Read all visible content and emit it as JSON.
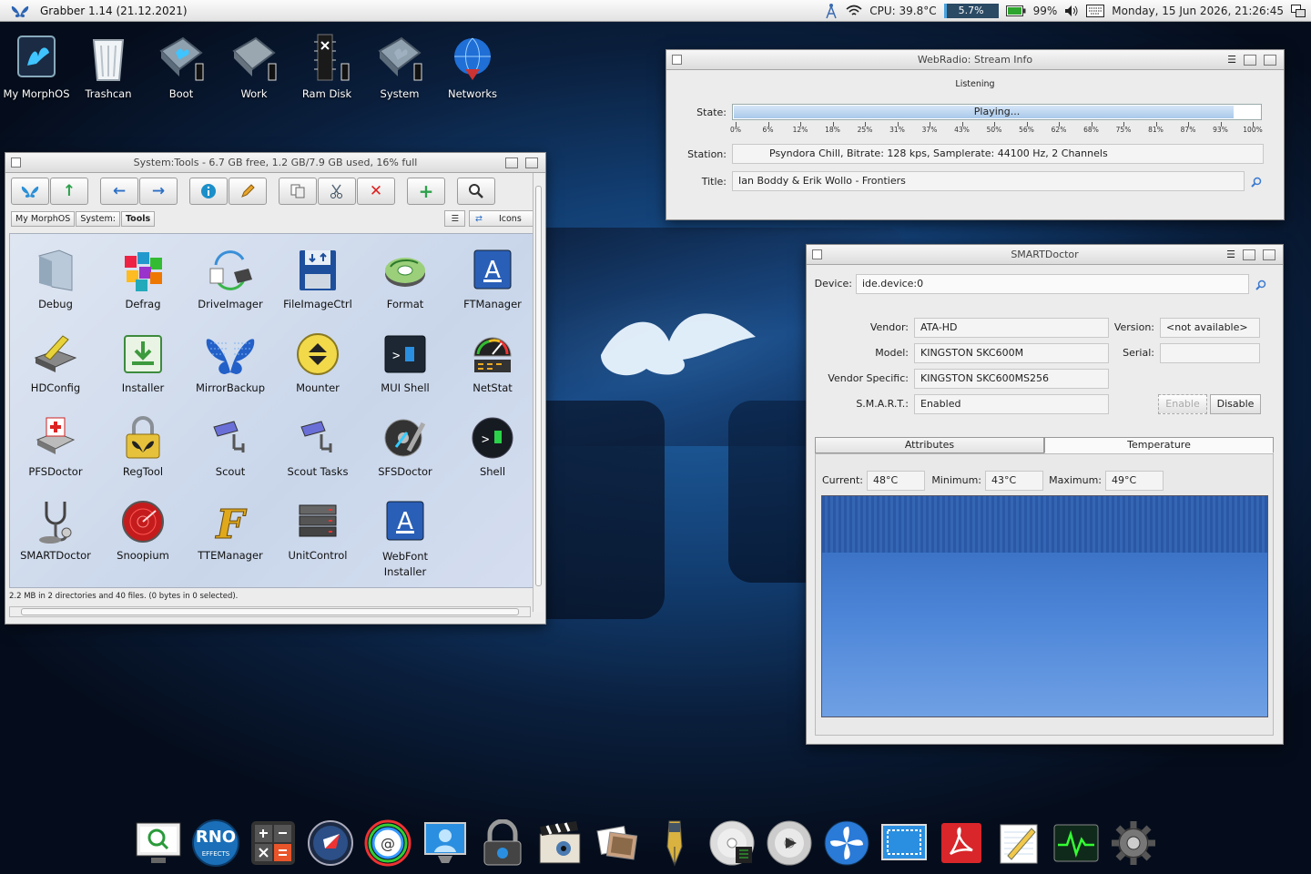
{
  "topbar": {
    "title": "Grabber 1.14 (21.12.2021)",
    "cpu_temp": "CPU: 39.8°C",
    "cpu_load": "5.7%",
    "cpu_load_fraction": 0.057,
    "battery": "99%",
    "datetime": "Monday, 15 Jun 2026, 21:26:45"
  },
  "desktop_icons": [
    {
      "label": "My MorphOS",
      "icon": "morphos-drive-icon"
    },
    {
      "label": "Trashcan",
      "icon": "trashcan-icon"
    },
    {
      "label": "Boot",
      "icon": "disk-icon"
    },
    {
      "label": "Work",
      "icon": "disk-icon"
    },
    {
      "label": "Ram Disk",
      "icon": "ramdisk-icon"
    },
    {
      "label": "System",
      "icon": "disk-icon"
    },
    {
      "label": "Networks",
      "icon": "globe-icon"
    }
  ],
  "tools_window": {
    "title": "System:Tools - 6.7 GB free, 1.2 GB/7.9 GB used, 16% full",
    "path": [
      "My MorphOS",
      "System:",
      "Tools"
    ],
    "view_mode": "Icons",
    "status": "2.2 MB in 2 directories and 40 files. (0 bytes in 0 selected).",
    "icons": [
      {
        "label": "Debug",
        "icon": "folder-icon"
      },
      {
        "label": "Defrag",
        "icon": "defrag-cubes-icon"
      },
      {
        "label": "DriveImager",
        "icon": "drive-imager-icon"
      },
      {
        "label": "FileImageCtrl",
        "icon": "floppy-icon"
      },
      {
        "label": "Format",
        "icon": "format-disk-icon"
      },
      {
        "label": "FTManager",
        "icon": "font-a-icon"
      },
      {
        "label": "HDConfig",
        "icon": "hdconfig-icon"
      },
      {
        "label": "Installer",
        "icon": "installer-icon"
      },
      {
        "label": "MirrorBackup",
        "icon": "butterfly-mosaic-icon"
      },
      {
        "label": "Mounter",
        "icon": "eject-icon"
      },
      {
        "label": "MUI Shell",
        "icon": "shell-window-icon"
      },
      {
        "label": "NetStat",
        "icon": "gauge-icon"
      },
      {
        "label": "PFSDoctor",
        "icon": "disk-cross-icon"
      },
      {
        "label": "RegTool",
        "icon": "padlock-icon"
      },
      {
        "label": "Scout",
        "icon": "camera-icon"
      },
      {
        "label": "Scout Tasks",
        "icon": "camera-icon"
      },
      {
        "label": "SFSDoctor",
        "icon": "disk-wrench-icon"
      },
      {
        "label": "Shell",
        "icon": "shell-round-icon"
      },
      {
        "label": "SMARTDoctor",
        "icon": "stethoscope-icon"
      },
      {
        "label": "Snoopium",
        "icon": "radar-icon"
      },
      {
        "label": "TTEManager",
        "icon": "font-f-icon"
      },
      {
        "label": "UnitControl",
        "icon": "drive-stack-icon"
      },
      {
        "label": "WebFont Installer",
        "icon": "font-a-icon"
      }
    ]
  },
  "webradio": {
    "title": "WebRadio: Stream Info",
    "heading": "Listening",
    "state_label": "State:",
    "state_value": "Playing...",
    "state_progress": 0.95,
    "scale": [
      "0%",
      "6%",
      "12%",
      "18%",
      "25%",
      "31%",
      "37%",
      "43%",
      "50%",
      "56%",
      "62%",
      "68%",
      "75%",
      "81%",
      "87%",
      "93%",
      "100%"
    ],
    "station_label": "Station:",
    "station_value": "Psyndora Chill, Bitrate: 128 kps, Samplerate: 44100 Hz, 2 Channels",
    "title_label": "Title:",
    "title_value": "Ian Boddy & Erik Wollo - Frontiers"
  },
  "smartdoctor": {
    "title": "SMARTDoctor",
    "device_label": "Device:",
    "device_value": "ide.device:0",
    "vendor_label": "Vendor:",
    "vendor_value": "ATA-HD",
    "version_label": "Version:",
    "version_value": "<not available>",
    "model_label": "Model:",
    "model_value": "KINGSTON SKC600M",
    "serial_label": "Serial:",
    "serial_value": "",
    "vendor_specific_label": "Vendor Specific:",
    "vendor_specific_value": "KINGSTON SKC600MS256",
    "smart_label": "S.M.A.R.T.:",
    "smart_value": "Enabled",
    "enable_btn": "Enable",
    "disable_btn": "Disable",
    "tabs": [
      "Attributes",
      "Temperature"
    ],
    "current_label": "Current:",
    "current_value": "48°C",
    "minimum_label": "Minimum:",
    "minimum_value": "43°C",
    "maximum_label": "Maximum:",
    "maximum_value": "49°C"
  },
  "dock": [
    "magnifier-monitor-icon",
    "rno-effects-icon",
    "calculator-icon",
    "compass-browser-icon",
    "email-icon",
    "screen-user-icon",
    "padlock-icon",
    "clapper-icon",
    "photos-icon",
    "pen-nib-icon",
    "cd-audio-icon",
    "cd-player-icon",
    "fan-icon",
    "screen-grab-icon",
    "pdf-icon",
    "notepad-icon",
    "activity-monitor-icon",
    "settings-gear-icon"
  ],
  "dock_rno": "RNO",
  "dock_rno_sub": "EFFECTS"
}
